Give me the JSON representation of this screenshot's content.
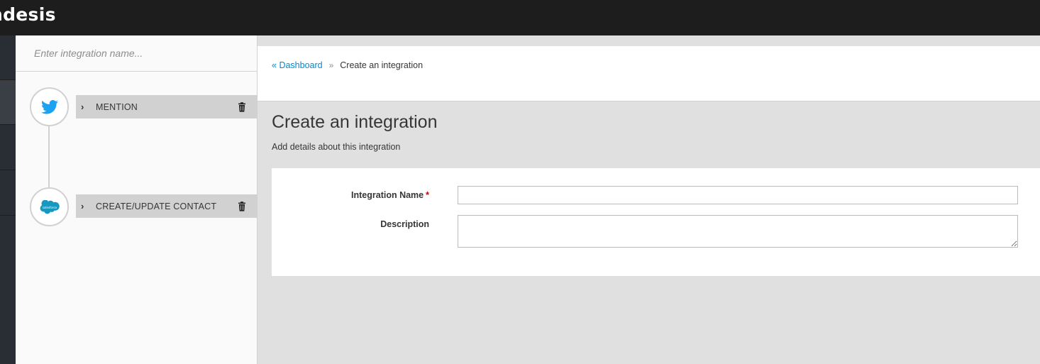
{
  "app": {
    "brand": "ndesis"
  },
  "flow_panel": {
    "name_input": {
      "placeholder": "Enter integration name...",
      "value": ""
    },
    "steps": [
      {
        "label": "MENTION",
        "icon": "twitter-icon",
        "color": "#1da1f2"
      },
      {
        "label": "CREATE/UPDATE CONTACT",
        "icon": "salesforce-icon",
        "color": "#1798c1"
      }
    ]
  },
  "breadcrumb": {
    "prefix": "«",
    "link": "Dashboard",
    "separator": "»",
    "current": "Create an integration"
  },
  "page": {
    "title": "Create an integration",
    "subtitle": "Add details about this integration"
  },
  "form": {
    "name_label": "Integration Name",
    "required_mark": "*",
    "name_value": "",
    "description_label": "Description",
    "description_value": ""
  },
  "colors": {
    "link": "#0088ce",
    "required": "#cc0000",
    "topbar": "#1d1d1d"
  }
}
